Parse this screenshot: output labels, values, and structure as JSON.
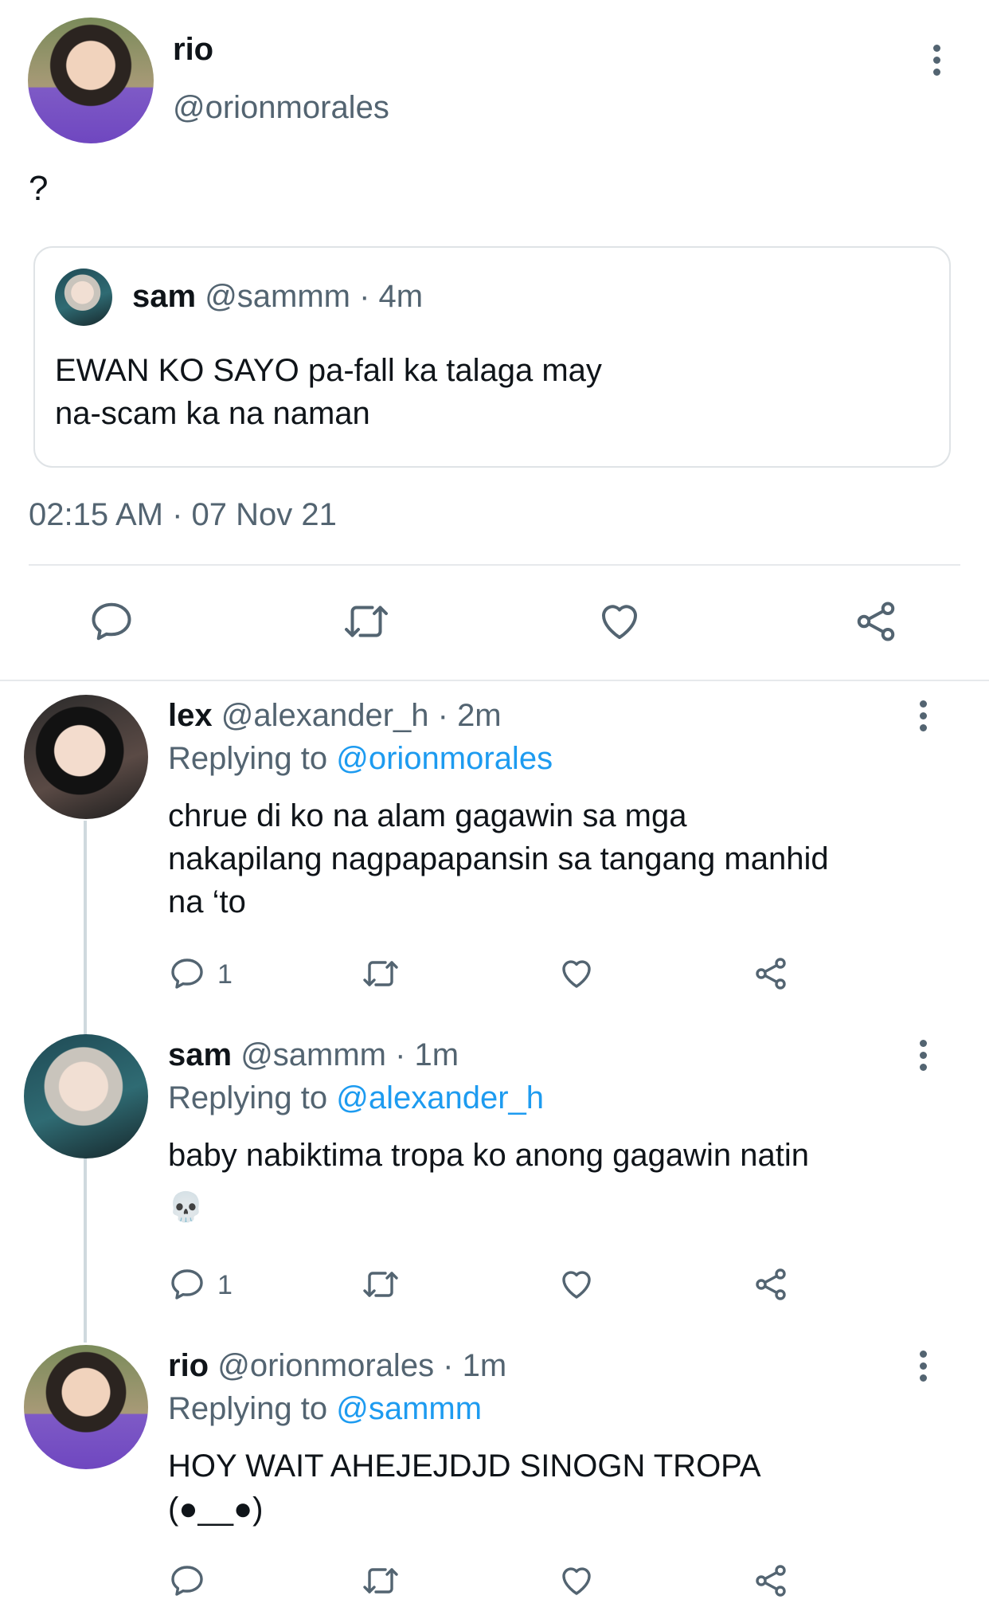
{
  "main_tweet": {
    "display_name": "rio",
    "handle": "@orionmorales",
    "text": "?",
    "quoted": {
      "display_name": "sam",
      "meta": "@sammm · 4m",
      "text_line1": "EWAN KO SAYO pa-fall ka talaga may",
      "text_line2": "na-scam ka na naman"
    },
    "timestamp": "02:15 AM · 07 Nov 21"
  },
  "replies": [
    {
      "display_name": "lex",
      "meta": "@alexander_h · 2m",
      "replying_prefix": "Replying to",
      "replying_to": "@orionmorales",
      "line1": "chrue di ko na alam gagawin sa mga",
      "line2": "nakapilang nagpapapansin sa tangang manhid",
      "line3": "na ‘to",
      "reply_count": "1"
    },
    {
      "display_name": "sam",
      "meta": "@sammm · 1m",
      "replying_prefix": "Replying to",
      "replying_to": "@alexander_h",
      "line1": "baby nabiktima tropa ko anong gagawin natin",
      "line2": "💀",
      "reply_count": "1"
    },
    {
      "display_name": "rio",
      "meta": "@orionmorales · 1m",
      "replying_prefix": "Replying to",
      "replying_to": "@sammm",
      "line1": "HOY WAIT AHEJEJDJD SINOGN TROPA",
      "line2": "(●__●)",
      "reply_count": ""
    }
  ],
  "icons": [
    "reply-icon",
    "retweet-icon",
    "like-icon",
    "share-icon",
    "more-icon"
  ],
  "colors": {
    "link": "#1d9bf0",
    "muted": "#536471",
    "text": "#0f1419",
    "divider": "#e6e9ec"
  }
}
